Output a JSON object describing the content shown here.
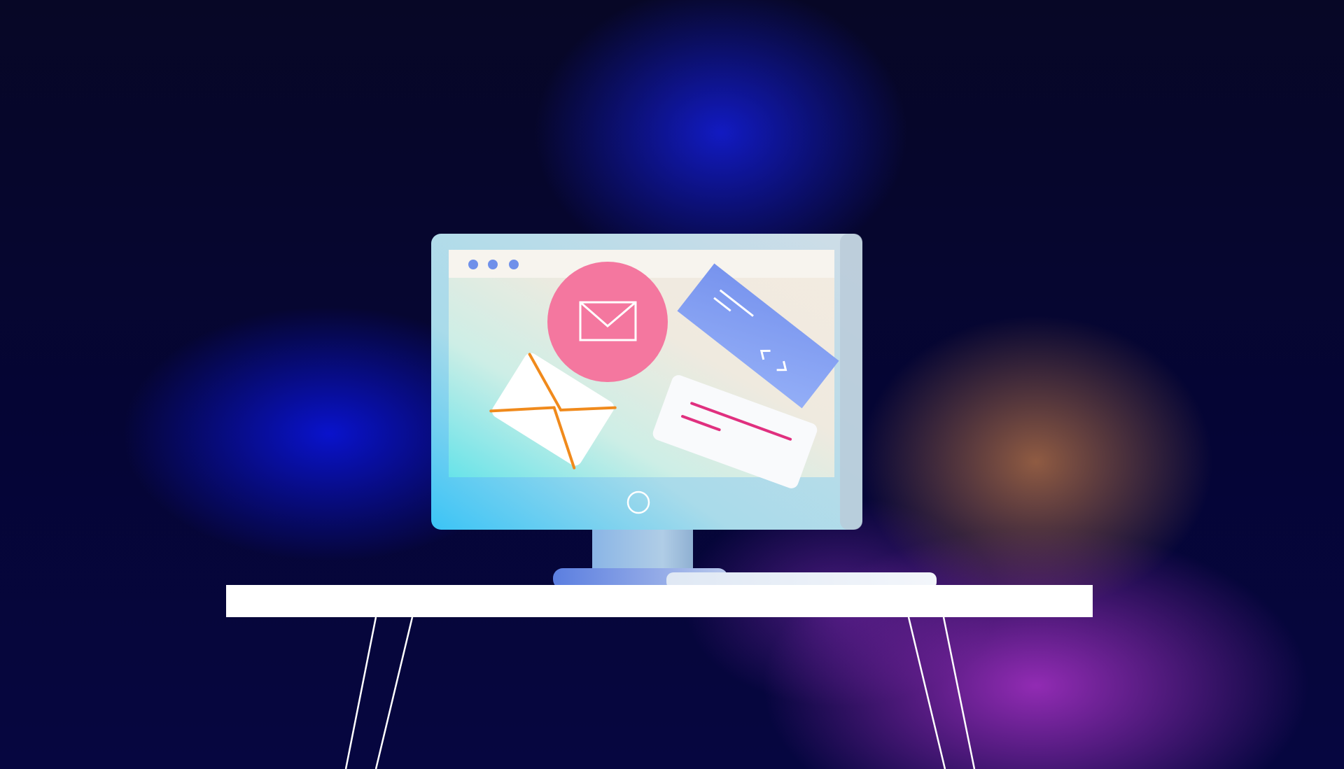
{
  "scene": {
    "kind": "illustration",
    "subject": "desktop-monitor-on-table",
    "colors": {
      "background_dark": "#06062a",
      "glow_blue": "#1420dc",
      "glow_orange": "#be7846",
      "glow_purple": "#aa32c8",
      "monitor_frame": "#c9dbe6",
      "screen_bg": "#f1ebe2",
      "mail_circle": "#f4779f",
      "blue_card": "#7f9cf0",
      "envelope_line": "#f08a1c",
      "text_card_line": "#e0307f",
      "table_top": "#ffffff"
    },
    "icons": [
      "envelope-icon",
      "code-brackets-icon",
      "window-dots-icon"
    ]
  }
}
